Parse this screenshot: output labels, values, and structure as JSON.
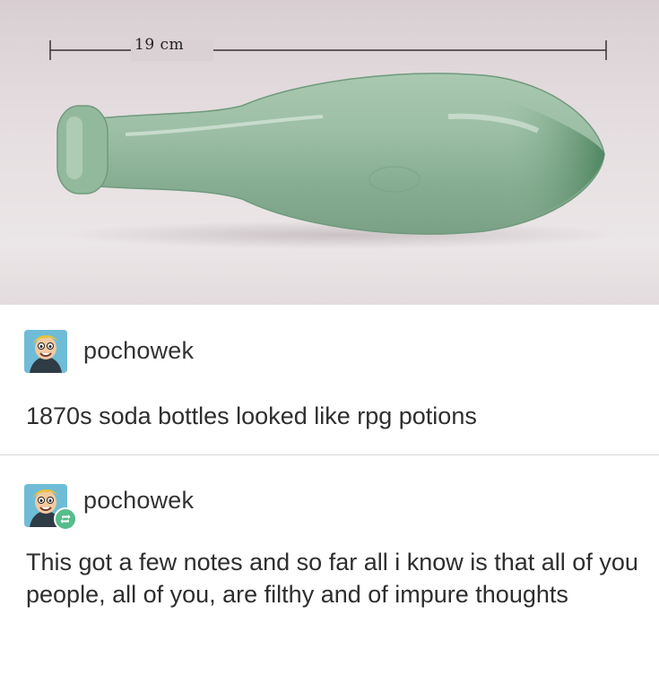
{
  "photo": {
    "measure_label": "19 cm",
    "subject_icon": "glass-bottle-icon"
  },
  "posts": [
    {
      "username": "pochowek",
      "avatar_icon": "cartoon-avatar-icon",
      "text": "1870s soda bottles looked like rpg potions"
    },
    {
      "username": "pochowek",
      "avatar_icon": "cartoon-avatar-icon",
      "badge_icon": "reblog-icon",
      "text": "This got a few notes and so far all i know is that all of you people, all of you, are filthy and of impure thoughts"
    }
  ],
  "colors": {
    "reblog_badge": "#56bc8a",
    "glass": "#8fb89a",
    "divider": "#d9d9d9"
  }
}
